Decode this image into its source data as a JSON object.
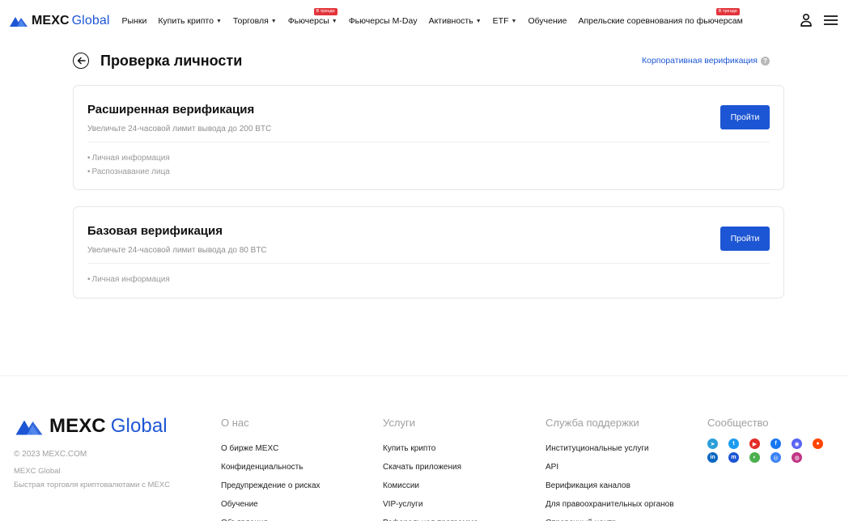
{
  "header": {
    "logo_word": "MEXC",
    "logo_suffix": "Global",
    "menu": [
      {
        "label": "Рынки",
        "caret": false,
        "badge": ""
      },
      {
        "label": "Купить крипто",
        "caret": true,
        "badge": ""
      },
      {
        "label": "Торговля",
        "caret": true,
        "badge": ""
      },
      {
        "label": "Фьючерсы",
        "caret": true,
        "badge": "В тренде"
      },
      {
        "label": "Фьючерсы M-Day",
        "caret": false,
        "badge": ""
      },
      {
        "label": "Активность",
        "caret": true,
        "badge": ""
      },
      {
        "label": "ETF",
        "caret": true,
        "badge": ""
      },
      {
        "label": "Обучение",
        "caret": false,
        "badge": ""
      },
      {
        "label": "Апрельские соревнования по фьючерсам",
        "caret": false,
        "badge": "В тренде"
      }
    ],
    "icons": [
      "user-icon",
      "menu-icon"
    ]
  },
  "page": {
    "title": "Проверка личности",
    "corporate_link": "Корпоративная верификация",
    "help_icon": "?"
  },
  "cards": [
    {
      "title": "Расширенная верификация",
      "subtitle": "Увеличьте 24-часовой лимит вывода до 200 BTC",
      "items": [
        "Личная информация",
        "Распознавание лица"
      ],
      "button": "Пройти"
    },
    {
      "title": "Базовая верификация",
      "subtitle": "Увеличьте 24-часовой лимит вывода до 80 BTC",
      "items": [
        "Личная информация"
      ],
      "button": "Пройти"
    }
  ],
  "footer": {
    "copyright": "© 2023 MEXC.COM",
    "brand": "MEXC Global",
    "description": "Быстрая торговля криптовалютами с MEXC",
    "columns": [
      {
        "title": "О нас",
        "links": [
          "О бирже MEXC",
          "Конфиденциальность",
          "Предупреждение о рисках",
          "Обучение",
          "Объявления"
        ]
      },
      {
        "title": "Услуги",
        "links": [
          "Купить крипто",
          "Скачать приложения",
          "Комиссии",
          "VIP-услуги",
          "Реферальная программа"
        ]
      },
      {
        "title": "Служба поддержки",
        "links": [
          "Институциональные услуги",
          "API",
          "Верификация каналов",
          "Для правоохранительных органов",
          "Справочный центр"
        ]
      }
    ],
    "community_title": "Сообщество",
    "socials": [
      [
        {
          "name": "telegram-icon",
          "color": "#2a9fd8"
        },
        {
          "name": "twitter-icon",
          "color": "#1d9bf0"
        },
        {
          "name": "youtube-icon",
          "color": "#e52d27"
        },
        {
          "name": "facebook-icon",
          "color": "#1877f2"
        },
        {
          "name": "discord-icon",
          "color": "#5865f2"
        },
        {
          "name": "reddit-icon",
          "color": "#ff4500"
        }
      ],
      [
        {
          "name": "linkedin-icon",
          "color": "#0a66c2"
        },
        {
          "name": "medium-icon",
          "color": "#1d56d4"
        },
        {
          "name": "coinmarketcap-icon",
          "color": "#4caf50"
        },
        {
          "name": "messenger-icon",
          "color": "#3b82f6"
        },
        {
          "name": "instagram-icon",
          "color": "#c13584"
        }
      ]
    ]
  }
}
